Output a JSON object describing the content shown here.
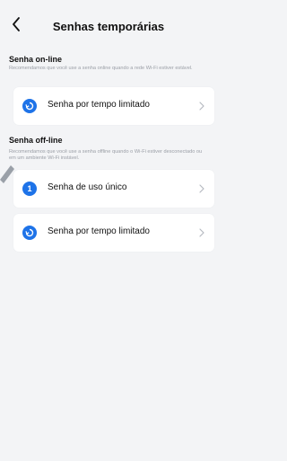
{
  "header": {
    "title": "Senhas temporárias"
  },
  "online": {
    "title": "Senha on-line",
    "description": "Recomendamos que você use a senha online quando a rede Wi-Fi estiver estável.",
    "items": [
      {
        "label": "Senha por tempo limitado",
        "icon": "refresh-icon"
      }
    ]
  },
  "offline": {
    "title": "Senha off-line",
    "description": "Recomendamos que você use a senha offline quando o Wi-Fi estiver desconectado ou em um ambiente Wi-Fi instável.",
    "items": [
      {
        "label": "Senha de uso único",
        "icon": "number-one-icon",
        "badge": "1"
      },
      {
        "label": "Senha por tempo limitado",
        "icon": "refresh-icon"
      }
    ]
  },
  "colors": {
    "accent": "#1e73e8",
    "background": "#f3f4f6",
    "card": "#ffffff",
    "muted": "#9a9ea6"
  }
}
